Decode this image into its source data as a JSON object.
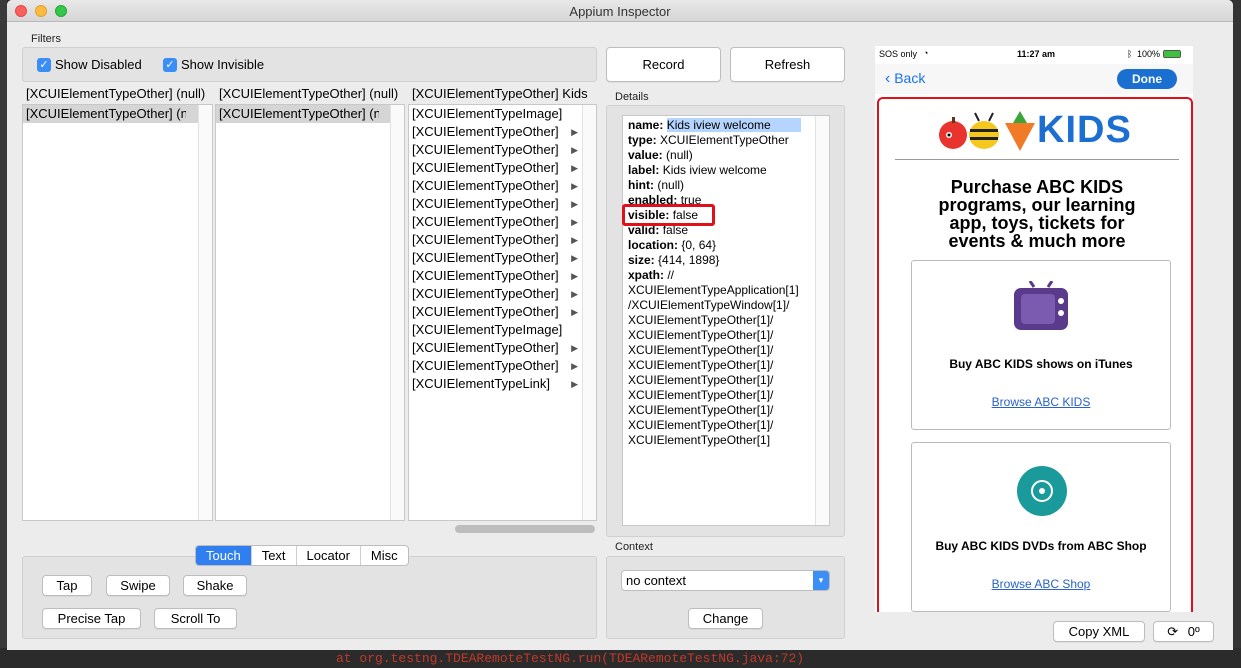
{
  "window": {
    "title": "Appium Inspector"
  },
  "filters": {
    "label": "Filters",
    "show_disabled": "Show Disabled",
    "show_invisible": "Show Invisible"
  },
  "toolbar": {
    "record": "Record",
    "refresh": "Refresh"
  },
  "columns": [
    {
      "header": "[XCUIElementTypeOther] (null)",
      "rows": [
        {
          "text": "[XCUIElementTypeOther] (null)",
          "arrow": true,
          "selected": true
        }
      ]
    },
    {
      "header": "[XCUIElementTypeOther] (null)",
      "rows": [
        {
          "text": "[XCUIElementTypeOther] (null)",
          "arrow": true,
          "selected": true
        }
      ]
    },
    {
      "header": "[XCUIElementTypeOther] Kids",
      "rows": [
        {
          "text": "[XCUIElementTypeImage]",
          "arrow": false
        },
        {
          "text": "[XCUIElementTypeOther]",
          "arrow": true
        },
        {
          "text": "[XCUIElementTypeOther]",
          "arrow": true
        },
        {
          "text": "[XCUIElementTypeOther]",
          "arrow": true
        },
        {
          "text": "[XCUIElementTypeOther]",
          "arrow": true
        },
        {
          "text": "[XCUIElementTypeOther]",
          "arrow": true
        },
        {
          "text": "[XCUIElementTypeOther]",
          "arrow": true
        },
        {
          "text": "[XCUIElementTypeOther]",
          "arrow": true
        },
        {
          "text": "[XCUIElementTypeOther]",
          "arrow": true
        },
        {
          "text": "[XCUIElementTypeOther]",
          "arrow": true
        },
        {
          "text": "[XCUIElementTypeOther]",
          "arrow": true
        },
        {
          "text": "[XCUIElementTypeOther]",
          "arrow": true
        },
        {
          "text": "[XCUIElementTypeImage]",
          "arrow": false
        },
        {
          "text": "[XCUIElementTypeOther]",
          "arrow": true
        },
        {
          "text": "[XCUIElementTypeOther]",
          "arrow": true
        },
        {
          "text": "[XCUIElementTypeLink]",
          "arrow": true
        }
      ]
    }
  ],
  "details": {
    "label": "Details",
    "lines": [
      {
        "key": "name:",
        "value": "Kids iview welcome",
        "highlight": true
      },
      {
        "key": "type:",
        "value": "XCUIElementTypeOther"
      },
      {
        "key": "value:",
        "value": "(null)"
      },
      {
        "key": "label:",
        "value": "Kids iview welcome"
      },
      {
        "key": "hint:",
        "value": "(null)"
      },
      {
        "key": "enabled:",
        "value": "true"
      },
      {
        "key": "visible:",
        "value": "false"
      },
      {
        "key": "valid:",
        "value": "false"
      },
      {
        "key": "location:",
        "value": "{0, 64}"
      },
      {
        "key": "size:",
        "value": "{414, 1898}"
      },
      {
        "key": "xpath:",
        "value": "//"
      },
      {
        "key": "",
        "value": "XCUIElementTypeApplication[1]"
      },
      {
        "key": "",
        "value": "/XCUIElementTypeWindow[1]/"
      },
      {
        "key": "",
        "value": "XCUIElementTypeOther[1]/"
      },
      {
        "key": "",
        "value": "XCUIElementTypeOther[1]/"
      },
      {
        "key": "",
        "value": "XCUIElementTypeOther[1]/"
      },
      {
        "key": "",
        "value": "XCUIElementTypeOther[1]/"
      },
      {
        "key": "",
        "value": "XCUIElementTypeOther[1]/"
      },
      {
        "key": "",
        "value": "XCUIElementTypeOther[1]/"
      },
      {
        "key": "",
        "value": "XCUIElementTypeOther[1]/"
      },
      {
        "key": "",
        "value": "XCUIElementTypeOther[1]/"
      },
      {
        "key": "",
        "value": "XCUIElementTypeOther[1]"
      }
    ]
  },
  "action_tabs": [
    "Touch",
    "Text",
    "Locator",
    "Misc"
  ],
  "touch": {
    "tap": "Tap",
    "swipe": "Swipe",
    "shake": "Shake",
    "precise_tap": "Precise Tap",
    "scroll_to": "Scroll To"
  },
  "context": {
    "label": "Context",
    "selected": "no context",
    "change": "Change"
  },
  "device": {
    "carrier": "SOS only",
    "time": "11:27 am",
    "battery": "100%",
    "back": "Back",
    "done": "Done",
    "logo_text": "KIDS",
    "headline": "Purchase ABC KIDS programs, our learning app, toys, tickets for events & much more",
    "card1_title": "Buy ABC KIDS shows on iTunes",
    "card1_link": "Browse ABC KIDS",
    "card2_title": "Buy ABC KIDS DVDs from ABC Shop",
    "card2_link": "Browse ABC Shop"
  },
  "footer": {
    "copy_xml": "Copy XML",
    "rotation": "0º"
  },
  "background": {
    "error_line": "at org.testng.TDEARemoteTestNG.run(TDEARemoteTestNG.java:72)"
  },
  "colors": {
    "accent": "#2f7ff0",
    "highlight_box": "#e0101a",
    "kids_blue": "#1c6fd1",
    "tv_purple": "#5a3a8a",
    "dvd_teal": "#1a9a9a"
  }
}
